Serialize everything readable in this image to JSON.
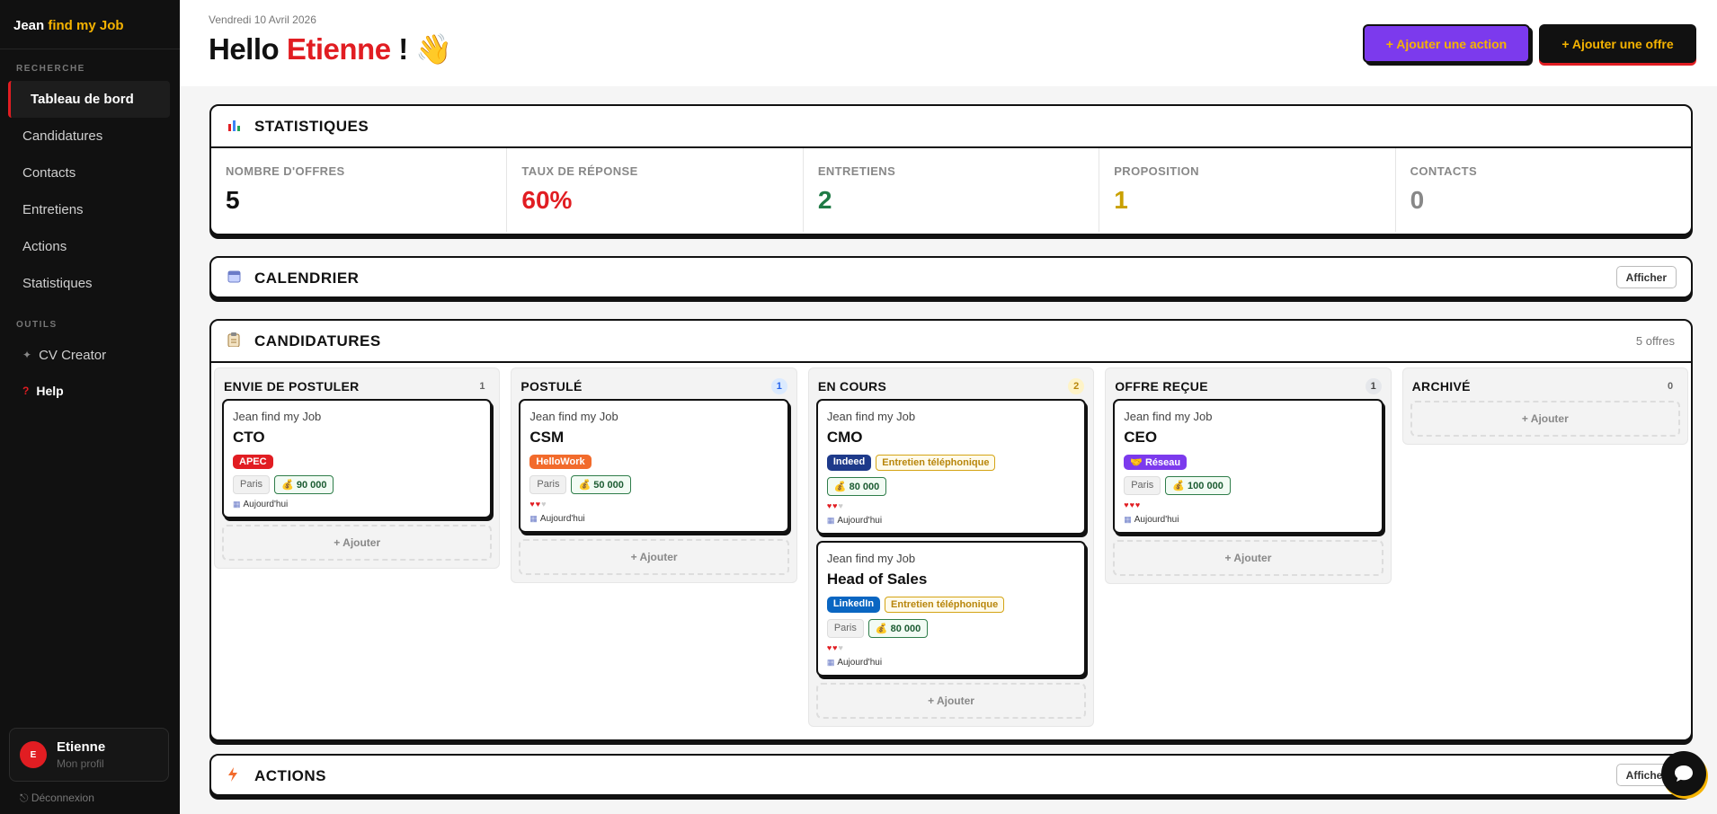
{
  "brand": {
    "prefix": "Jean ",
    "accent": "find my Job"
  },
  "sidebar": {
    "section_search": "RECHERCHE",
    "items": [
      {
        "label": "Tableau de bord"
      },
      {
        "label": "Candidatures"
      },
      {
        "label": "Contacts"
      },
      {
        "label": "Entretiens"
      },
      {
        "label": "Actions"
      },
      {
        "label": "Statistiques"
      }
    ],
    "section_tools": "OUTILS",
    "tools": [
      {
        "label": "CV Creator",
        "icon": "sparkle-icon"
      },
      {
        "label": "Help",
        "icon": "question-icon"
      }
    ],
    "profile": {
      "initial": "E",
      "name": "Etienne",
      "sub": "Mon profil"
    },
    "logout": "Déconnexion"
  },
  "header": {
    "date": "Vendredi 10 Avril 2026",
    "greeting": "Hello ",
    "name": "Etienne",
    "suffix": " ! ",
    "emoji": "👋",
    "btn_action": "+ Ajouter une action",
    "btn_offre": "+ Ajouter une offre"
  },
  "stats": {
    "title": "STATISTIQUES",
    "items": [
      {
        "label": "NOMBRE D'OFFRES",
        "value": "5",
        "color": "#111111"
      },
      {
        "label": "TAUX DE RÉPONSE",
        "value": "60%",
        "color": "#e11d22"
      },
      {
        "label": "ENTRETIENS",
        "value": "2",
        "color": "#1f7a45"
      },
      {
        "label": "PROPOSITION",
        "value": "1",
        "color": "#c9a000"
      },
      {
        "label": "CONTACTS",
        "value": "0",
        "color": "#888888"
      }
    ]
  },
  "calendar": {
    "title": "CALENDRIER",
    "show": "Afficher"
  },
  "candidatures": {
    "title": "CANDIDATURES",
    "count_label": "5 offres",
    "add_label": "+ Ajouter",
    "columns": [
      {
        "title": "ENVIE DE POSTULER",
        "count": "1"
      },
      {
        "title": "POSTULÉ",
        "count": "1"
      },
      {
        "title": "EN COURS",
        "count": "2"
      },
      {
        "title": "OFFRE REÇUE",
        "count": "1"
      },
      {
        "title": "ARCHIVÉ",
        "count": "0"
      }
    ],
    "cards": [
      {
        "company": "Jean find my Job",
        "role": "CTO",
        "source": "APEC",
        "city": "Paris",
        "salary": "90 000",
        "due": "Aujourd'hui"
      },
      {
        "company": "Jean find my Job",
        "role": "CSM",
        "source": "HelloWork",
        "city": "Paris",
        "salary": "50 000",
        "hearts": "♥♥",
        "hearts_off": "♥",
        "due": "Aujourd'hui"
      },
      {
        "company": "Jean find my Job",
        "role": "CMO",
        "source": "Indeed",
        "stage": "Entretien téléphonique",
        "salary": "80 000",
        "hearts": "♥♥",
        "hearts_off": "♥",
        "due": "Aujourd'hui"
      },
      {
        "company": "Jean find my Job",
        "role": "Head of Sales",
        "source": "LinkedIn",
        "stage": "Entretien téléphonique",
        "city": "Paris",
        "salary": "80 000",
        "hearts": "♥♥",
        "hearts_off": "♥",
        "due": "Aujourd'hui"
      },
      {
        "company": "Jean find my Job",
        "role": "CEO",
        "source": "🤝 Réseau",
        "city": "Paris",
        "salary": "100 000",
        "hearts": "♥♥♥",
        "due": "Aujourd'hui"
      }
    ]
  },
  "actions": {
    "title": "ACTIONS",
    "show": "Afficher"
  },
  "colors": {
    "accent_red": "#e11d22",
    "accent_yellow": "#f5b301",
    "purple": "#7c3aed"
  }
}
